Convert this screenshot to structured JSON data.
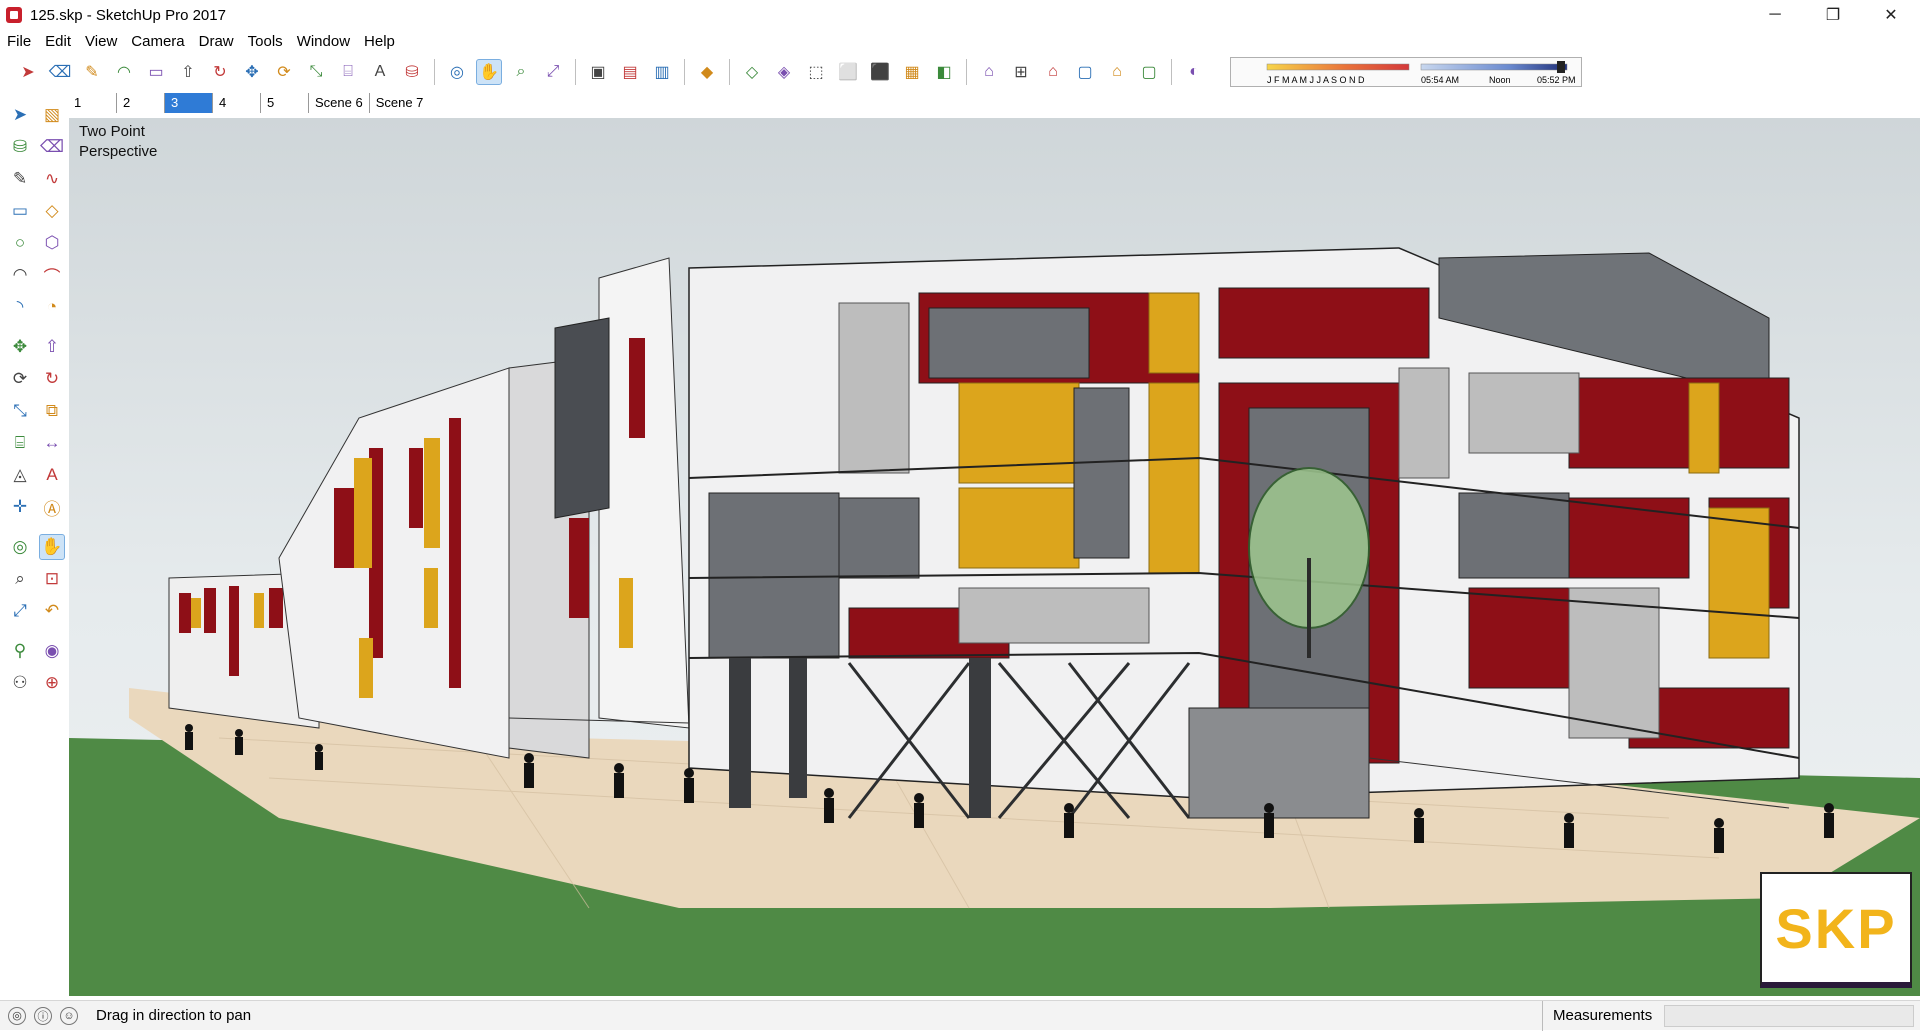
{
  "window": {
    "title": "125.skp - SketchUp Pro 2017",
    "minimize": "─",
    "maximize": "❐",
    "close": "✕"
  },
  "menu": [
    "File",
    "Edit",
    "View",
    "Camera",
    "Draw",
    "Tools",
    "Window",
    "Help"
  ],
  "toolbar": {
    "icons": [
      "select-icon",
      "eraser-icon",
      "line-icon",
      "arc-icon",
      "rectangle-icon",
      "push-pull-icon",
      "follow-me-icon",
      "move-icon",
      "rotate-icon",
      "scale-icon",
      "tape-measure-icon",
      "text-icon",
      "paint-bucket-icon",
      "orbit-icon",
      "pan-icon",
      "zoom-icon",
      "zoom-extents-icon",
      "warehouse-icon",
      "extension-warehouse-icon",
      "layout-icon",
      "ruby-icon",
      "xray-icon",
      "back-edges-icon",
      "wireframe-icon",
      "hidden-line-icon",
      "shaded-icon",
      "textured-icon",
      "monochrome-icon",
      "iso-view-icon",
      "top-view-icon",
      "front-view-icon",
      "right-view-icon",
      "back-view-icon",
      "left-view-icon",
      "shadows-icon"
    ],
    "active": "pan-icon",
    "shadow": {
      "months": "J F M A M J J A S O N D",
      "time_start": "05:54 AM",
      "time_mid": "Noon",
      "time_end": "05:52 PM"
    }
  },
  "scenes": {
    "tabs": [
      "1",
      "2",
      "3",
      "4",
      "5",
      "Scene 6",
      "Scene 7"
    ],
    "active": "3"
  },
  "left_toolbar": {
    "icons": [
      "select-icon",
      "component-icon",
      "paint-bucket-icon",
      "eraser-icon",
      "line-icon",
      "freehand-icon",
      "rectangle-icon",
      "rotated-rectangle-icon",
      "circle-icon",
      "polygon-icon",
      "arc-icon",
      "two-point-arc-icon",
      "three-point-arc-icon",
      "pie-icon",
      "move-icon",
      "push-pull-icon",
      "rotate-icon",
      "follow-me-icon",
      "scale-icon",
      "offset-icon",
      "tape-measure-icon",
      "dimension-icon",
      "protractor-icon",
      "text-icon",
      "axes-icon",
      "3d-text-icon",
      "orbit-icon",
      "pan-icon",
      "zoom-icon",
      "zoom-window-icon",
      "zoom-extents-icon",
      "previous-view-icon",
      "position-camera-icon",
      "look-around-icon",
      "walk-icon",
      "section-plane-icon"
    ]
  },
  "viewport": {
    "camera_label_line1": "Two Point",
    "camera_label_line2": "Perspective",
    "badge": "SKP",
    "colors": {
      "sky": "#d7dde0",
      "ground": "#4f8a45",
      "plaza": "#ead8bd",
      "wall": "#f1f1f2",
      "accent_red": "#8e0f17",
      "accent_yellow": "#dca51c",
      "glass": "#6f7378"
    }
  },
  "status": {
    "message": "Drag in direction to pan",
    "measurements_label": "Measurements",
    "measurements_value": ""
  }
}
